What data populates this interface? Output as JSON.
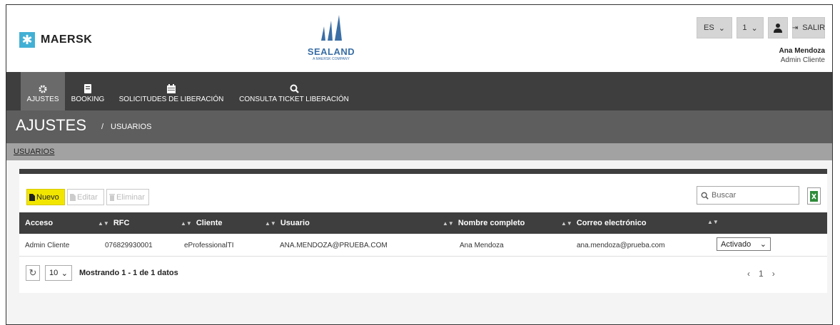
{
  "header": {
    "brand": "MAERSK",
    "partner_brand": "SEALAND",
    "partner_sub": "A MAERSK COMPANY",
    "language": "ES",
    "account_index": "1",
    "logout_label": "SALIR",
    "user_name": "Ana Mendoza",
    "user_role": "Admin Cliente",
    "brand_color": "#42b0d5",
    "partner_color": "#3a6ea5"
  },
  "nav": {
    "items": [
      {
        "label": "AJUSTES",
        "icon": "gear-icon",
        "active": true
      },
      {
        "label": "BOOKING",
        "icon": "book-icon",
        "active": false
      },
      {
        "label": "SOLICITUDES DE LIBERACIÓN",
        "icon": "calendar-icon",
        "active": false
      },
      {
        "label": "CONSULTA TICKET LIBERACIÓN",
        "icon": "search-icon",
        "active": false
      }
    ]
  },
  "breadcrumb": {
    "title": "AJUSTES",
    "separator": "/",
    "current": "USUARIOS"
  },
  "subtab": {
    "label": "USUARIOS"
  },
  "toolbar": {
    "new_label": "Nuevo",
    "edit_label": "Editar",
    "delete_label": "Eliminar",
    "search_placeholder": "Buscar",
    "accent": "#f2e600"
  },
  "table": {
    "columns": [
      "Acceso",
      "RFC",
      "Cliente",
      "Usuario",
      "Nombre completo",
      "Correo electrónico",
      ""
    ],
    "rows": [
      {
        "acceso": "Admin Cliente",
        "rfc": "076829930001",
        "cliente": "eProfessionalTI",
        "usuario": "ANA.MENDOZA@PRUEBA.COM",
        "nombre": "Ana Mendoza",
        "correo": "ana.mendoza@prueba.com",
        "estado": "Activado"
      }
    ]
  },
  "footer": {
    "page_size": "10",
    "summary": "Mostrando 1 - 1 de 1 datos",
    "prev": "‹",
    "page": "1",
    "next": "›"
  }
}
